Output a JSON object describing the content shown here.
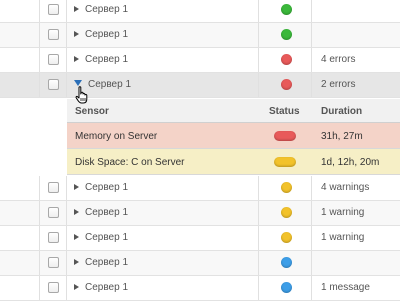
{
  "colors": {
    "green": "#3bb83b",
    "red": "#e85a5a",
    "yellow": "#f2c22b",
    "blue": "#3d9ee8",
    "alert_bg": "#f4d3c8",
    "warning_bg": "#f6efc6"
  },
  "servers_top": [
    {
      "name": "Сервер 1",
      "status": "green",
      "info": ""
    },
    {
      "name": "Сервер 1",
      "status": "green",
      "info": ""
    },
    {
      "name": "Сервер 1",
      "status": "red",
      "info": "4 errors"
    },
    {
      "name": "Сервер 1",
      "status": "red",
      "info": "2 errors"
    }
  ],
  "details": {
    "columns": {
      "sensor": "Sensor",
      "status": "Status",
      "duration": "Duration"
    },
    "rows": [
      {
        "sensor": "Memory on Server",
        "status": "red",
        "duration": "31h, 27m"
      },
      {
        "sensor": "Disk Space: C on Server",
        "status": "yellow",
        "duration": "1d, 12h, 20m"
      }
    ]
  },
  "servers_bottom": [
    {
      "name": "Сервер 1",
      "status": "yellow",
      "info": "4 warnings"
    },
    {
      "name": "Сервер 1",
      "status": "yellow",
      "info": "1 warning"
    },
    {
      "name": "Сервер 1",
      "status": "yellow",
      "info": "1 warning"
    },
    {
      "name": "Сервер 1",
      "status": "blue",
      "info": ""
    },
    {
      "name": "Сервер 1",
      "status": "blue",
      "info": "1 message"
    }
  ]
}
